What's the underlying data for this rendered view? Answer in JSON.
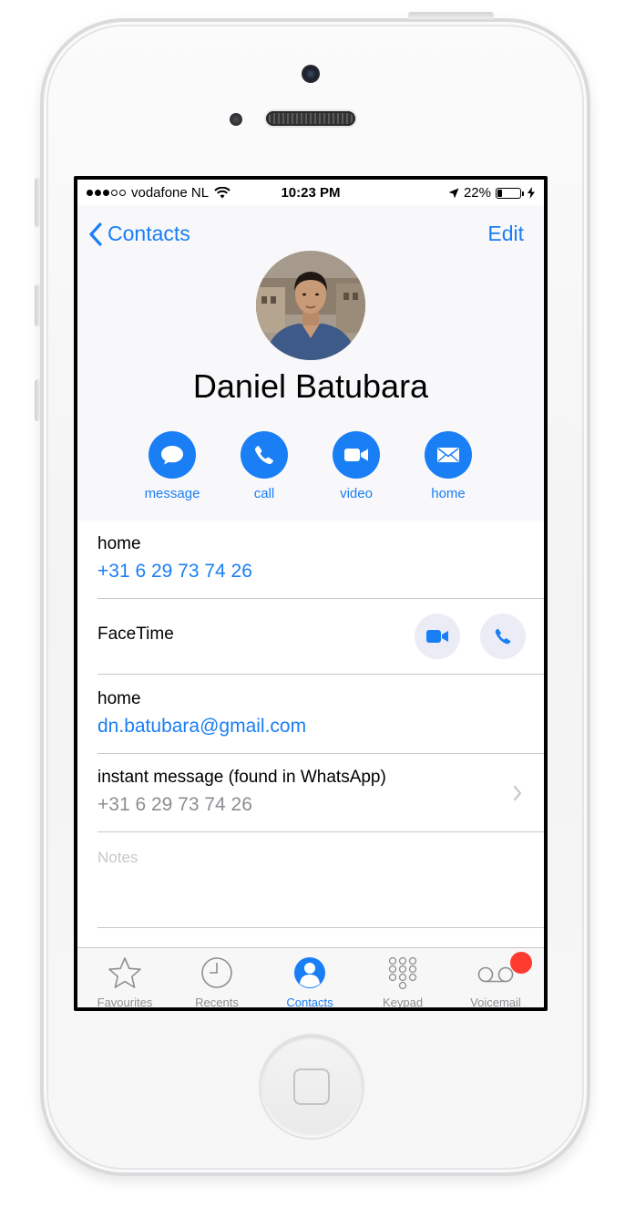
{
  "status_bar": {
    "carrier": "vodafone NL",
    "time": "10:23 PM",
    "battery": "22%",
    "signal_bars_filled": 3,
    "signal_bars_total": 5,
    "battery_level": 0.22
  },
  "nav": {
    "back_label": "Contacts",
    "edit_label": "Edit"
  },
  "contact": {
    "name": "Daniel Batubara"
  },
  "actions": [
    {
      "label": "message",
      "icon": "message-bubble-icon"
    },
    {
      "label": "call",
      "icon": "phone-icon"
    },
    {
      "label": "video",
      "icon": "video-camera-icon"
    },
    {
      "label": "home",
      "icon": "envelope-icon"
    }
  ],
  "phone": {
    "label": "home",
    "value": "+31 6 29 73 74 26"
  },
  "facetime": {
    "label": "FaceTime"
  },
  "email": {
    "label": "home",
    "value": "dn.batubara@gmail.com"
  },
  "instant_message": {
    "label": "instant message (found in WhatsApp)",
    "value": "+31 6 29 73 74 26"
  },
  "notes": {
    "placeholder": "Notes"
  },
  "tabs": [
    {
      "label": "Favourites",
      "icon": "star-icon",
      "active": false
    },
    {
      "label": "Recents",
      "icon": "clock-icon",
      "active": false
    },
    {
      "label": "Contacts",
      "icon": "person-icon",
      "active": true
    },
    {
      "label": "Keypad",
      "icon": "keypad-icon",
      "active": false
    },
    {
      "label": "Voicemail",
      "icon": "voicemail-icon",
      "active": false
    }
  ],
  "colors": {
    "accent": "#1a7ef5",
    "badge": "#ff3b30",
    "secondary_text": "#8e8e93"
  }
}
